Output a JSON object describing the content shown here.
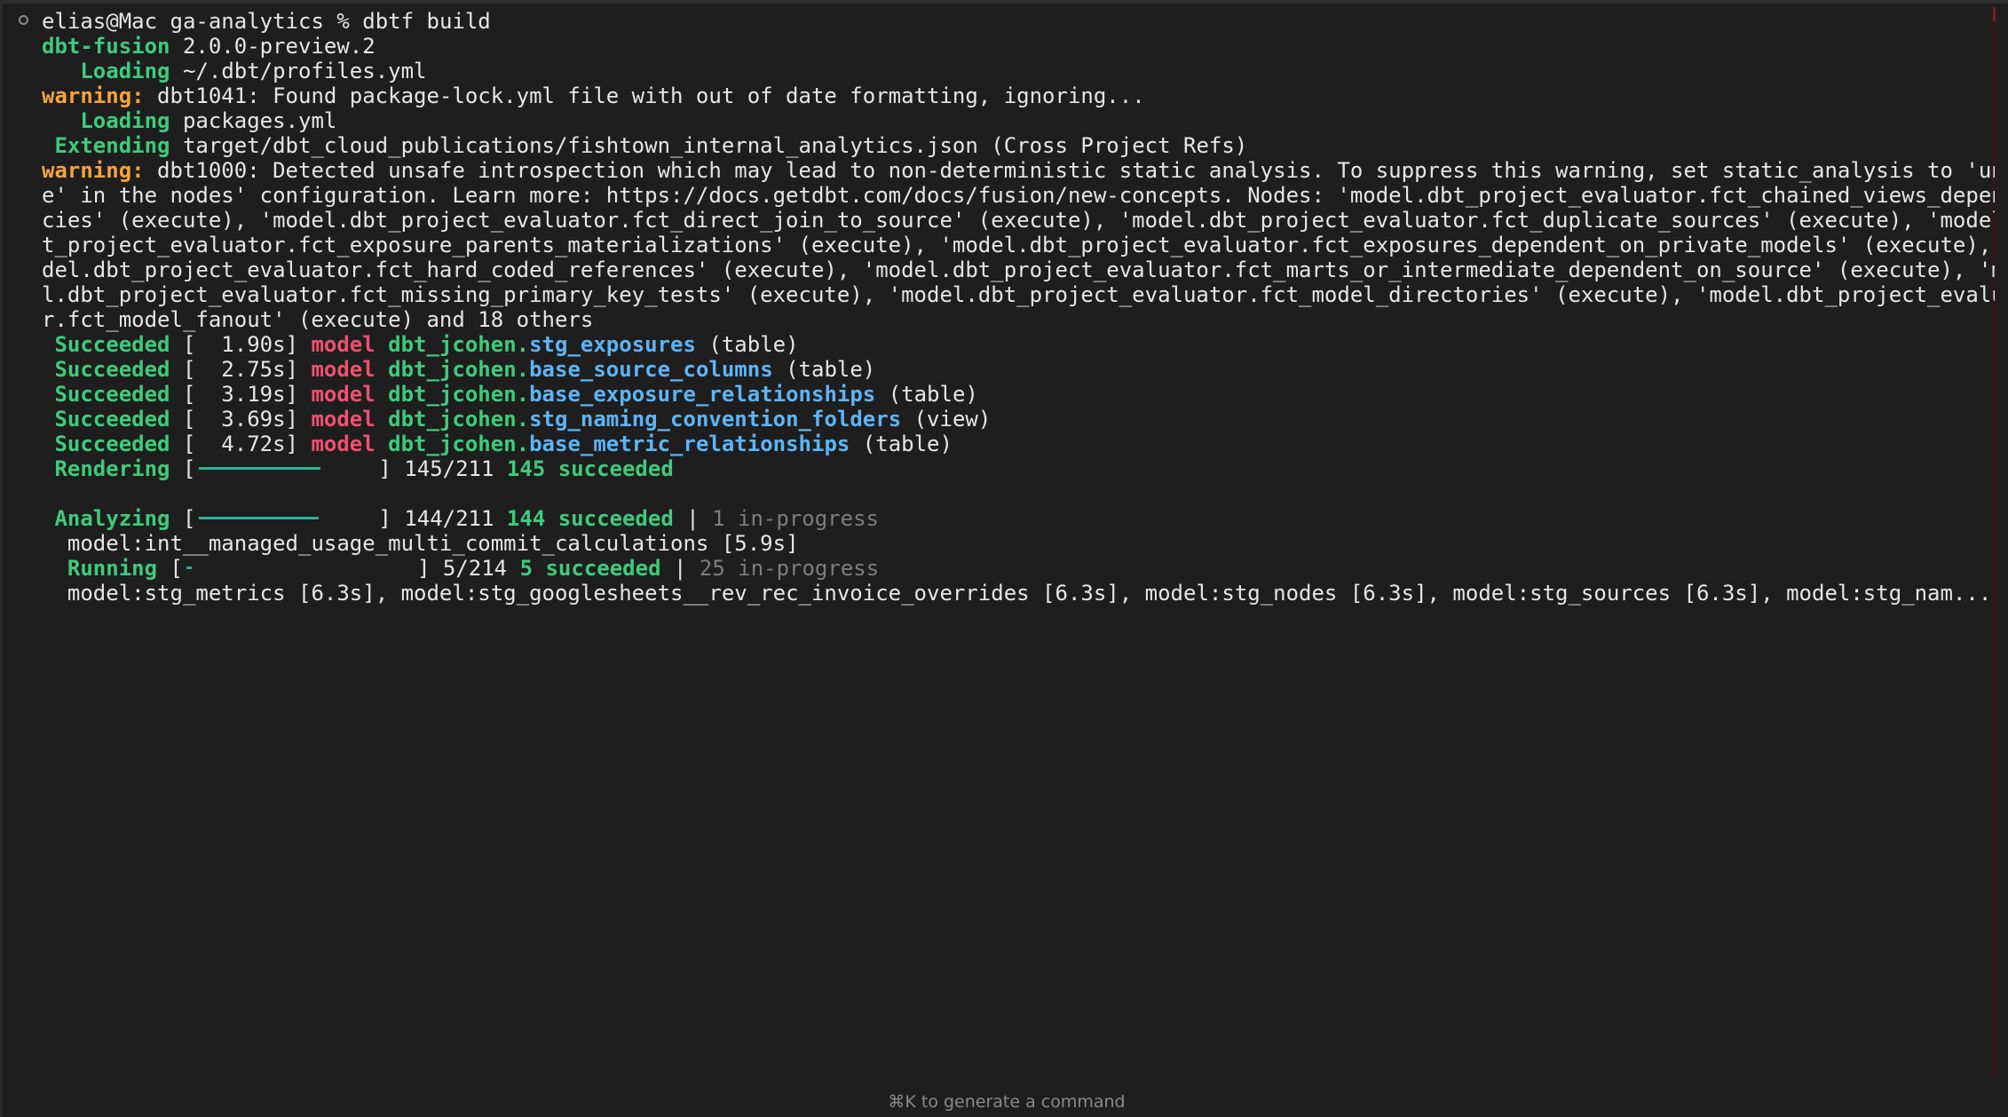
{
  "prompt": {
    "user_host": "elias@Mac",
    "directory": "ga-analytics",
    "symbol": "%",
    "command": "dbtf build"
  },
  "header": {
    "tool_name": "dbt-fusion",
    "version": "2.0.0-preview.2"
  },
  "loading_profiles": {
    "label": "Loading",
    "text": "~/.dbt/profiles.yml"
  },
  "warning_1": {
    "label": "warning:",
    "text": "dbt1041: Found package-lock.yml file with out of date formatting, ignoring..."
  },
  "loading_packages": {
    "label": "Loading",
    "text": "packages.yml"
  },
  "extending": {
    "label": "Extending",
    "text": "target/dbt_cloud_publications/fishtown_internal_analytics.json (Cross Project Refs)"
  },
  "warning_2": {
    "label": "warning:",
    "lines": [
      "dbt1000: Detected unsafe introspection which may lead to non-deterministic static analysis. To suppress this warning, set static_analysis to 'unsaf",
      "e' in the nodes' configuration. Learn more: https://docs.getdbt.com/docs/fusion/new-concepts. Nodes: 'model.dbt_project_evaluator.fct_chained_views_dependen",
      "cies' (execute), 'model.dbt_project_evaluator.fct_direct_join_to_source' (execute), 'model.dbt_project_evaluator.fct_duplicate_sources' (execute), 'model.db",
      "t_project_evaluator.fct_exposure_parents_materializations' (execute), 'model.dbt_project_evaluator.fct_exposures_dependent_on_private_models' (execute), 'mo",
      "del.dbt_project_evaluator.fct_hard_coded_references' (execute), 'model.dbt_project_evaluator.fct_marts_or_intermediate_dependent_on_source' (execute), 'mode",
      "l.dbt_project_evaluator.fct_missing_primary_key_tests' (execute), 'model.dbt_project_evaluator.fct_model_directories' (execute), 'model.dbt_project_evaluato",
      "r.fct_model_fanout' (execute) and 18 others"
    ]
  },
  "succeeded_rows": [
    {
      "status": "Succeeded",
      "time": "[  1.90s]",
      "kind": "model",
      "schema": "dbt_jcohen.",
      "name": "stg_exposures",
      "mat": "(table)"
    },
    {
      "status": "Succeeded",
      "time": "[  2.75s]",
      "kind": "model",
      "schema": "dbt_jcohen.",
      "name": "base_source_columns",
      "mat": "(table)"
    },
    {
      "status": "Succeeded",
      "time": "[  3.19s]",
      "kind": "model",
      "schema": "dbt_jcohen.",
      "name": "base_exposure_relationships",
      "mat": "(table)"
    },
    {
      "status": "Succeeded",
      "time": "[  3.69s]",
      "kind": "model",
      "schema": "dbt_jcohen.",
      "name": "stg_naming_convention_folders",
      "mat": "(view)"
    },
    {
      "status": "Succeeded",
      "time": "[  4.72s]",
      "kind": "model",
      "schema": "dbt_jcohen.",
      "name": "base_metric_relationships",
      "mat": "(table)"
    }
  ],
  "rendering": {
    "label": "Rendering",
    "open": "[",
    "close": "]",
    "count": "145/211",
    "succeeded": "145 succeeded",
    "progress": 0.69
  },
  "analyzing": {
    "label": "Analyzing",
    "open": "[",
    "close": "]",
    "count": "144/211",
    "succeeded": "144 succeeded",
    "separator": "|",
    "in_progress": "1 in-progress",
    "progress": 0.68,
    "current": "model:int__managed_usage_multi_commit_calculations [5.9s]"
  },
  "running": {
    "label": "Running",
    "open": "[",
    "close": "]",
    "count": "5/214",
    "succeeded": "5 succeeded",
    "separator": "|",
    "in_progress": "25 in-progress",
    "progress": 0.023,
    "current": "model:stg_metrics [6.3s], model:stg_googlesheets__rev_rec_invoice_overrides [6.3s], model:stg_nodes [6.3s], model:stg_sources [6.3s], model:stg_nam..."
  },
  "footer_hint": "⌘K to generate a command"
}
